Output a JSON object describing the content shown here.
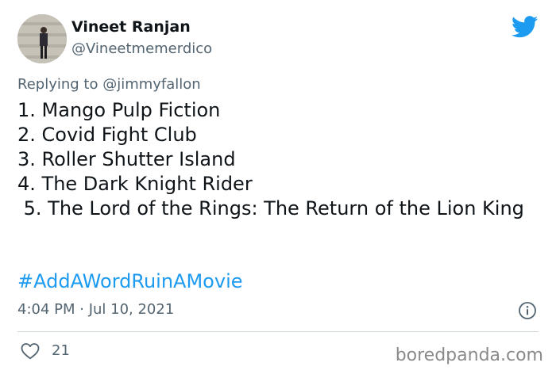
{
  "author": {
    "name": "Vineet Ranjan",
    "handle": "@Vineetmemerdico"
  },
  "reply": {
    "prefix": "Replying to ",
    "mention": "@jimmyfallon"
  },
  "body_lines": [
    "1. Mango Pulp Fiction",
    "2. Covid Fight Club",
    "3. Roller Shutter Island",
    "4. The Dark Knight Rider",
    " 5. The Lord of the Rings: The Return of the Lion King"
  ],
  "hashtag": "#AddAWordRuinAMovie",
  "timestamp": "4:04 PM · Jul 10, 2021",
  "likes": "21",
  "watermark": "boredpanda.com",
  "colors": {
    "link": "#1d9bf0",
    "secondary_text": "#536471",
    "divider": "#cfd9de"
  },
  "icons": {
    "logo": "twitter-bird-icon",
    "info": "info-icon",
    "like": "heart-icon"
  }
}
